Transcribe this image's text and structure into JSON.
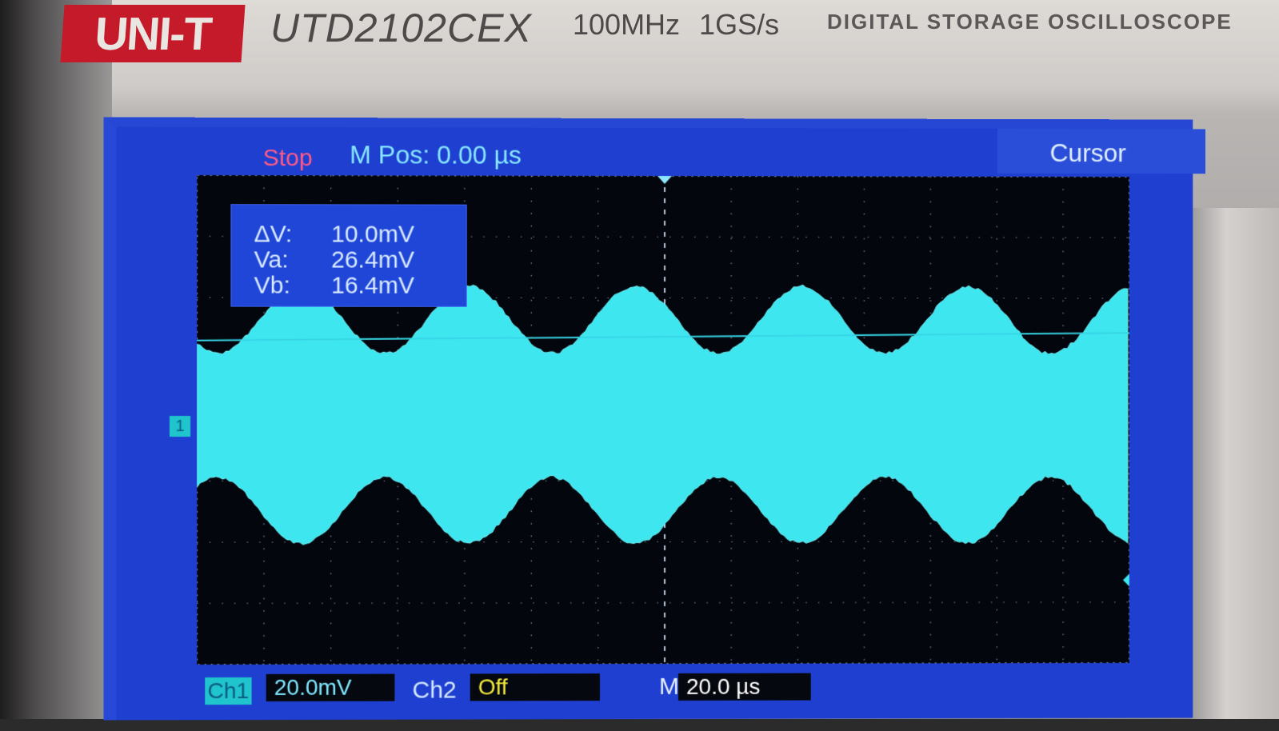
{
  "device": {
    "brand": "UNI-T",
    "model": "UTD2102CEX",
    "specs": "100MHz 1GS/s",
    "product_line": "DIGITAL STORAGE OSCILLOSCOPE"
  },
  "status_bar": {
    "run_state": "Stop",
    "horizontal_position": "M Pos: 0.00 µs",
    "menu_title": "Cursor"
  },
  "cursor_readout": {
    "rows": [
      {
        "label": "ΔV:",
        "value": "10.0mV"
      },
      {
        "label": "Va:",
        "value": "26.4mV"
      },
      {
        "label": "Vb:",
        "value": "16.4mV"
      }
    ]
  },
  "channels": {
    "ch1": {
      "tag": "Ch1",
      "scale": "20.0mV",
      "marker": "1"
    },
    "ch2": {
      "tag": "Ch2",
      "state": "Off"
    }
  },
  "timebase": {
    "label": "M",
    "scale": "20.0 µs"
  },
  "colors": {
    "screen_bg": "#1e3fd0",
    "trace": "#3ee6f0",
    "stop_text": "#ff5a87",
    "off_text": "#f2ea3a",
    "brand_red": "#c41a2a"
  }
}
